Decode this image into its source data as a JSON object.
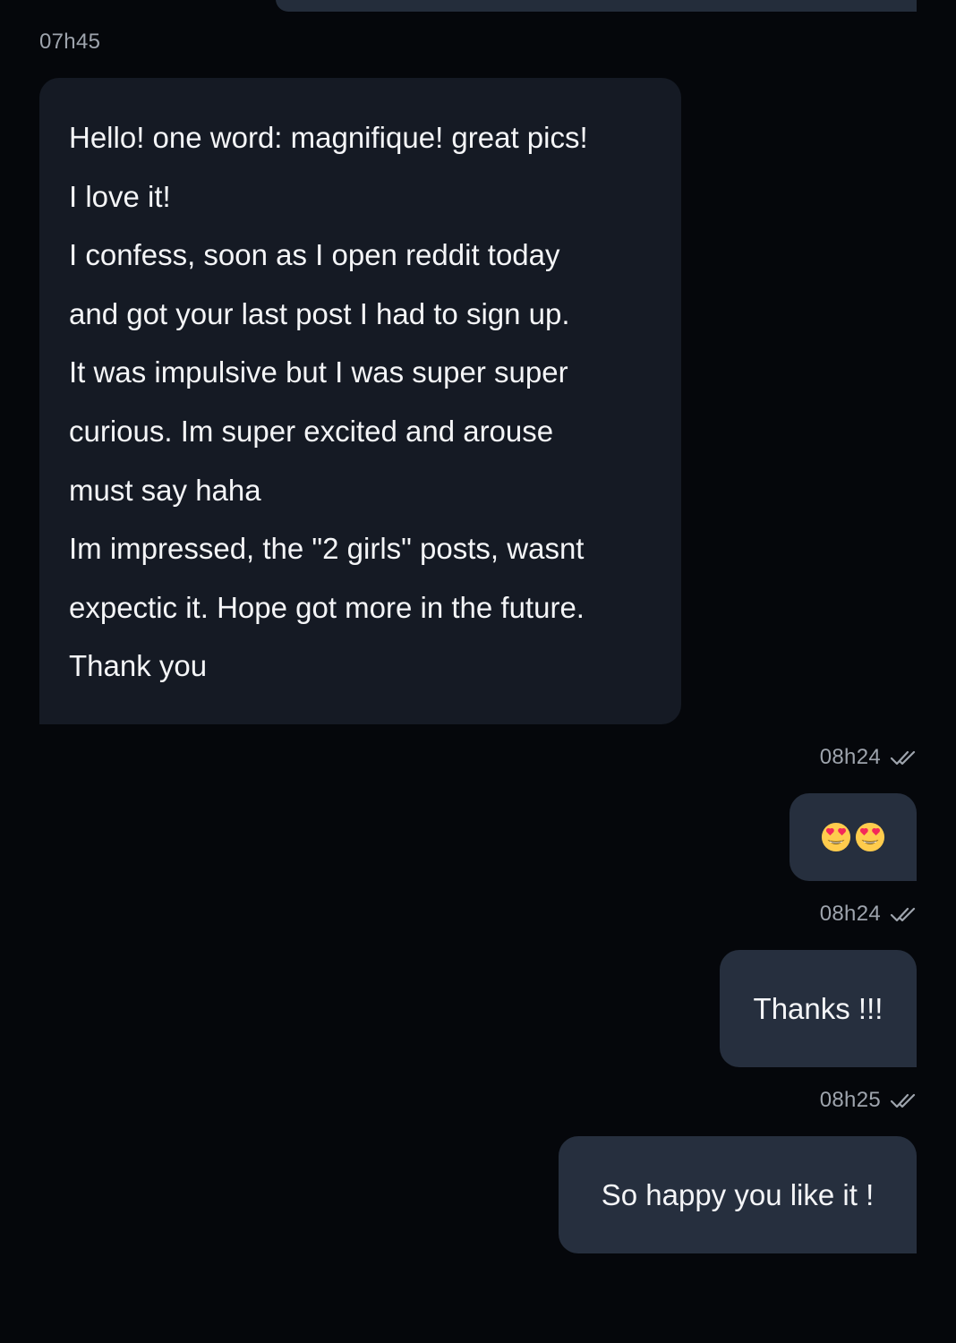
{
  "messages": [
    {
      "direction": "received",
      "time": "07h45",
      "lines": [
        "Hello! one word: magnifique! great pics!",
        "I love it!",
        "I confess, soon as I open reddit today",
        "and got your last post I had to sign up.",
        "It was impulsive but I was super super",
        "curious. Im super excited and arouse",
        "must say haha",
        "Im impressed, the \"2 girls\" posts, wasnt",
        "expectic it. Hope got more in the future.",
        "Thank you"
      ]
    },
    {
      "direction": "sent",
      "time": "08h24",
      "status_icon": "double-check-icon",
      "content": "heart-eyes-emoji x2"
    },
    {
      "direction": "sent",
      "time": "08h24",
      "status_icon": "double-check-icon",
      "text": "Thanks !!!"
    },
    {
      "direction": "sent",
      "time": "08h25",
      "status_icon": "double-check-icon",
      "text": "So happy you like it !"
    }
  ],
  "colors": {
    "background": "#05070b",
    "received_bubble": "#151a24",
    "sent_bubble": "#262f3e",
    "timestamp": "#9ea4ad",
    "text": "#f4f5f7"
  }
}
